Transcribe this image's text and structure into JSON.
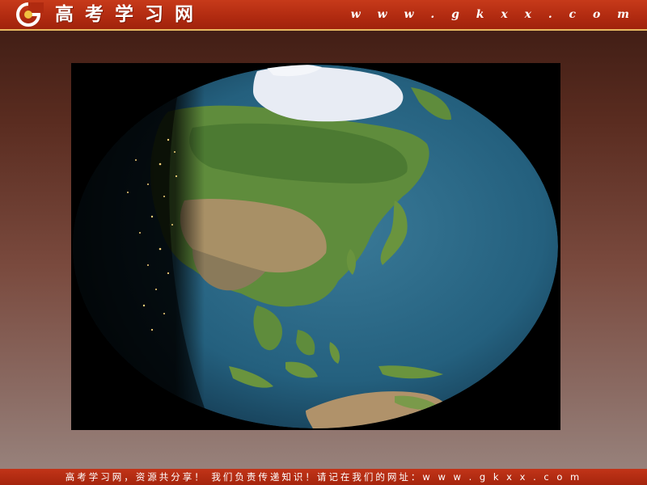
{
  "header": {
    "brand": "高考学习网",
    "url": "w w w . g k x x . c o m",
    "logo_icon": "gkxx-logo-icon"
  },
  "main": {
    "image_icon": "earth-globe-day-night-image"
  },
  "footer": {
    "text": "高考学习网，资源共分享！ 我们负责传递知识！请记在我们的网址：w w w . g k x x . c o m"
  },
  "colors": {
    "header_red": "#b02a10",
    "footer_red": "#a5250d",
    "ocean": "#2a6a8a",
    "land": "#5a8a3a"
  }
}
